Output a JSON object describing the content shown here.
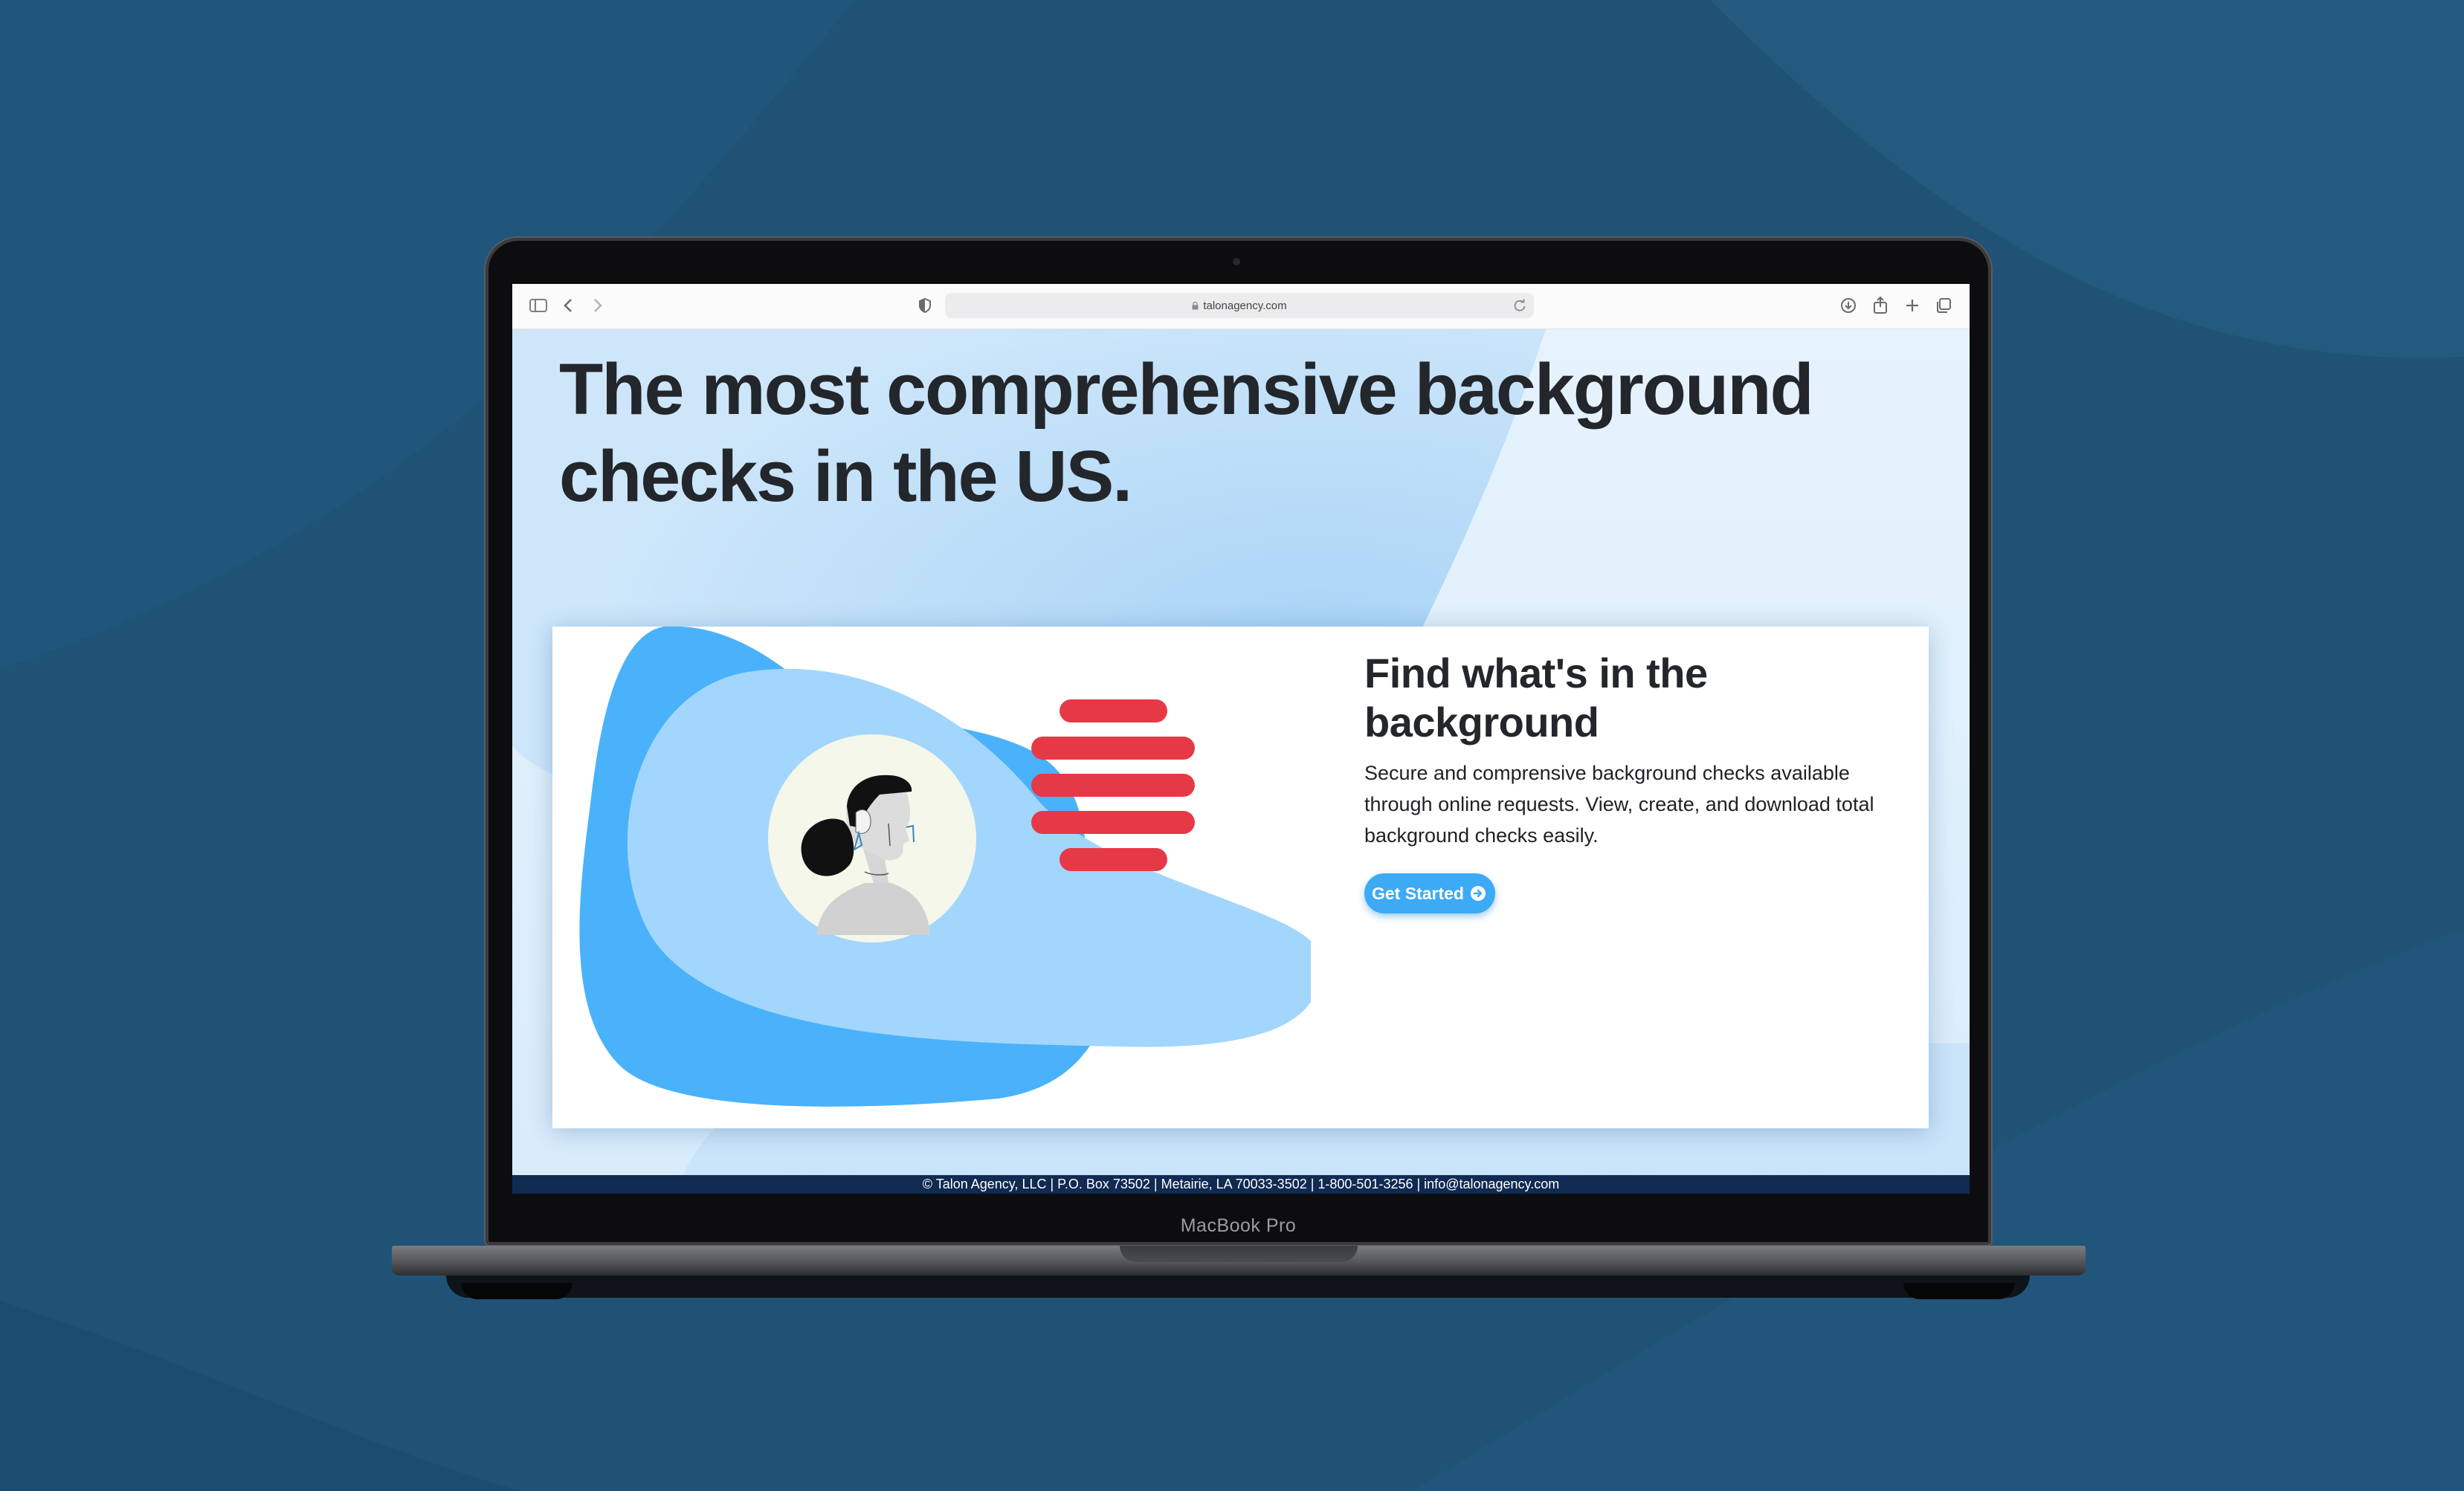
{
  "device": {
    "label": "MacBook Pro"
  },
  "browser": {
    "address": "talonagency.com",
    "icons": [
      "sidebar-icon",
      "back-icon",
      "forward-icon",
      "privacy-shield-icon",
      "lock-icon",
      "reload-icon",
      "download-icon",
      "share-icon",
      "new-tab-icon",
      "tabs-overview-icon"
    ]
  },
  "hero": {
    "headline": "The most comprehensive background checks in the US."
  },
  "feature_card": {
    "title": "Find what's in the background",
    "description": "Secure and comprensive background checks available through online requests. View, create, and download total background checks easily.",
    "cta_label": "Get Started",
    "cta_icon": "arrow-circle-right-icon"
  },
  "footer": {
    "text": "© Talon Agency, LLC | P.O. Box 73502 | Metairie, LA 70033-3502 | 1-800-501-3256 | info@talonagency.com"
  },
  "colors": {
    "desktop_background": "#1f5275",
    "accent_blue": "#3daaf5",
    "blob_dark": "#4ab2fa",
    "blob_light": "#a3d6fc",
    "redaction_red": "#e63946",
    "footer_background": "#102a52",
    "text_dark": "#23262b"
  }
}
